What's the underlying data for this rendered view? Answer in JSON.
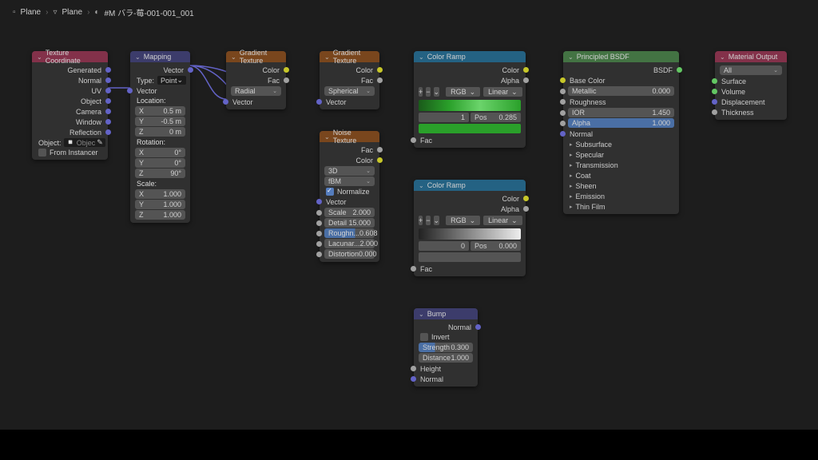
{
  "breadcrumb": {
    "a": "Plane",
    "b": "Plane",
    "c": "#M バラ-莓-001-001_001"
  },
  "texcoord": {
    "title": "Texture Coordinate",
    "outs": [
      "Generated",
      "Normal",
      "UV",
      "Object",
      "Camera",
      "Window",
      "Reflection"
    ],
    "object_label": "Object:",
    "object_value": "Objec",
    "from_instancer": "From Instancer"
  },
  "mapping": {
    "title": "Mapping",
    "out": "Vector",
    "type_label": "Type:",
    "type_value": "Point",
    "vector_in": "Vector",
    "loc_label": "Location:",
    "loc": [
      [
        "X",
        "0.5 m"
      ],
      [
        "Y",
        "-0.5 m"
      ],
      [
        "Z",
        "0 m"
      ]
    ],
    "rot_label": "Rotation:",
    "rot": [
      [
        "X",
        "0°"
      ],
      [
        "Y",
        "0°"
      ],
      [
        "Z",
        "90°"
      ]
    ],
    "scale_label": "Scale:",
    "scale": [
      [
        "X",
        "1.000"
      ],
      [
        "Y",
        "1.000"
      ],
      [
        "Z",
        "1.000"
      ]
    ]
  },
  "grad1": {
    "title": "Gradient Texture",
    "color": "Color",
    "fac": "Fac",
    "mode": "Radial",
    "vector": "Vector"
  },
  "grad2": {
    "title": "Gradient Texture",
    "color": "Color",
    "fac": "Fac",
    "mode": "Spherical",
    "vector": "Vector"
  },
  "noise": {
    "title": "Noise Texture",
    "fac": "Fac",
    "color": "Color",
    "dim": "3D",
    "basis": "fBM",
    "normalize": "Normalize",
    "vector": "Vector",
    "params": [
      [
        "Scale",
        "2.000"
      ],
      [
        "Detail",
        "15.000"
      ],
      [
        "Roughn...",
        "0.608"
      ],
      [
        "Lacunar...",
        "2.000"
      ],
      [
        "Distortion",
        "0.000"
      ]
    ],
    "rough_idx": 2
  },
  "ramp1": {
    "title": "Color Ramp",
    "color": "Color",
    "alpha": "Alpha",
    "mode": "RGB",
    "interp": "Linear",
    "idx": "1",
    "pos_label": "Pos",
    "pos": "0.285",
    "fac": "Fac"
  },
  "ramp2": {
    "title": "Color Ramp",
    "color": "Color",
    "alpha": "Alpha",
    "mode": "RGB",
    "interp": "Linear",
    "idx": "0",
    "pos_label": "Pos",
    "pos": "0.000",
    "fac": "Fac"
  },
  "bump": {
    "title": "Bump",
    "normal_out": "Normal",
    "invert": "Invert",
    "strength": [
      "Strength",
      "0.300"
    ],
    "distance": [
      "Distance",
      "1.000"
    ],
    "height": "Height",
    "normal_in": "Normal"
  },
  "bsdf": {
    "title": "Principled BSDF",
    "out": "BSDF",
    "base_color": "Base Color",
    "metallic": [
      "Metallic",
      "0.000"
    ],
    "roughness": "Roughness",
    "ior": [
      "IOR",
      "1.450"
    ],
    "alpha": [
      "Alpha",
      "1.000"
    ],
    "normal": "Normal",
    "groups": [
      "Subsurface",
      "Specular",
      "Transmission",
      "Coat",
      "Sheen",
      "Emission",
      "Thin Film"
    ]
  },
  "output": {
    "title": "Material Output",
    "all": "All",
    "surface": "Surface",
    "volume": "Volume",
    "displacement": "Displacement",
    "thickness": "Thickness"
  }
}
